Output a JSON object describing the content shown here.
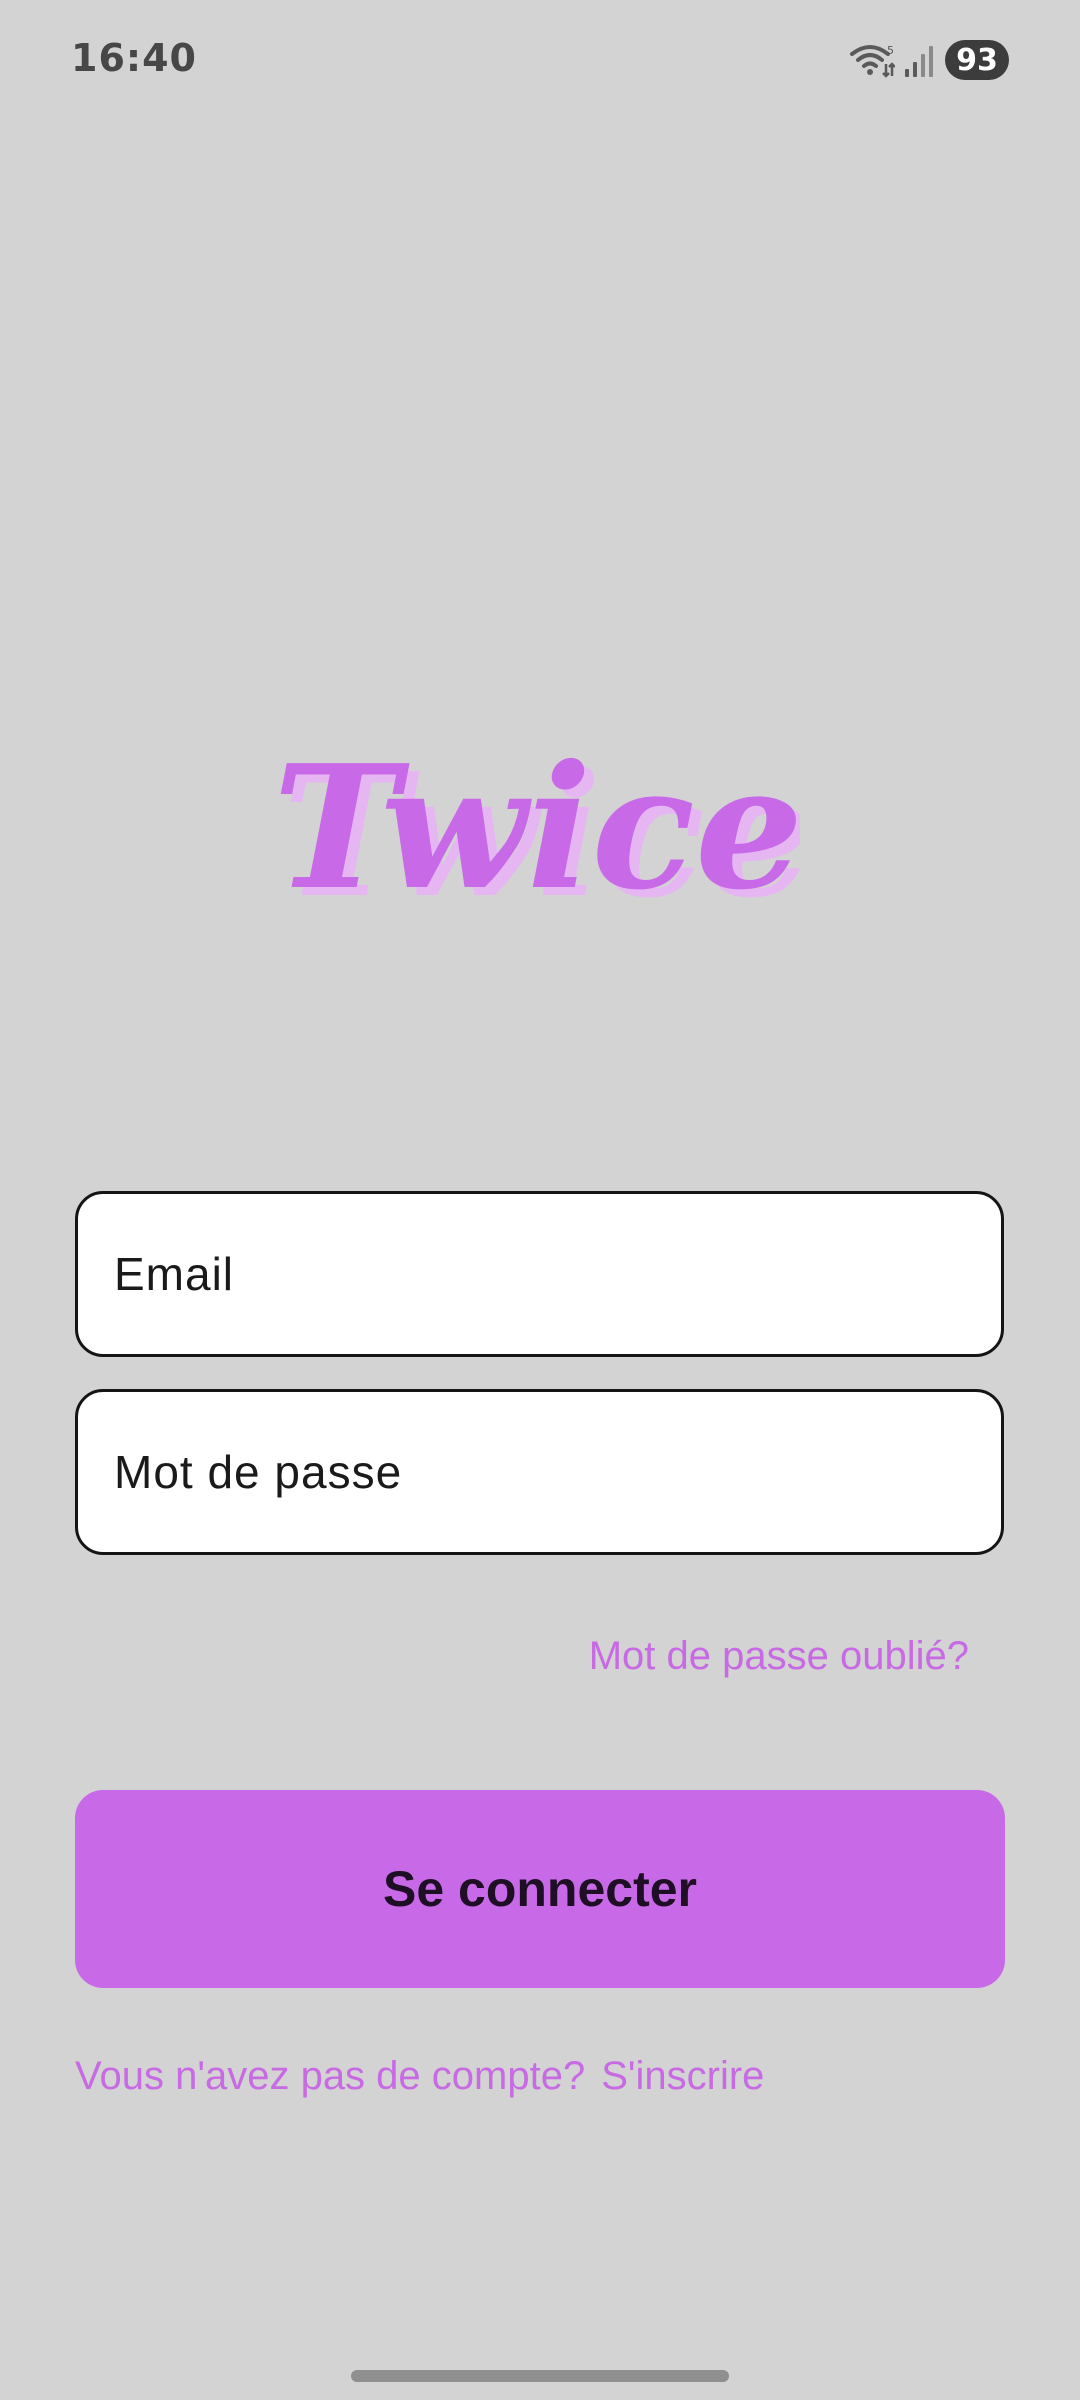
{
  "status_bar": {
    "time": "16:40",
    "wifi_badge": "5",
    "battery": "93",
    "icons": [
      "wifi-icon",
      "signal-icon",
      "battery-icon"
    ]
  },
  "app": {
    "logo_text": "Twice"
  },
  "form": {
    "email_placeholder": "Email",
    "password_placeholder": "Mot de passe",
    "forgot_password": "Mot de passe oublié?",
    "submit_label": "Se connecter"
  },
  "footer": {
    "no_account": "Vous n'avez pas de compte?",
    "signup": "S'inscrire"
  },
  "colors": {
    "background": "#d3d3d3",
    "accent": "#c86ae8",
    "accent_light": "#e6b6f2",
    "text_dark": "#1a1a1a"
  }
}
